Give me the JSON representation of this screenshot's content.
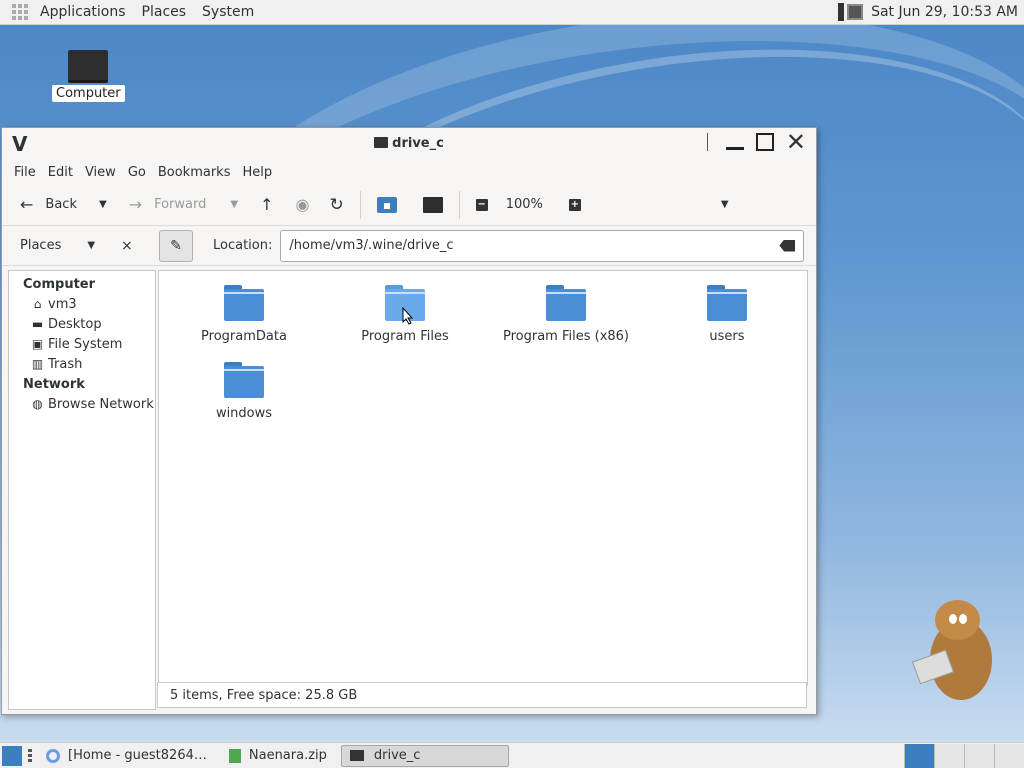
{
  "top_panel": {
    "menus": [
      "Applications",
      "Places",
      "System"
    ],
    "clock": "Sat Jun 29, 10:53 AM"
  },
  "desktop": {
    "icon_label": "Computer"
  },
  "window": {
    "logo": "V",
    "title": "drive_c",
    "menu": [
      "File",
      "Edit",
      "View",
      "Go",
      "Bookmarks",
      "Help"
    ],
    "toolbar": {
      "back": "Back",
      "forward": "Forward",
      "zoom": "100%"
    },
    "places": {
      "label": "Places",
      "close": "×"
    },
    "location": {
      "label": "Location:",
      "value": "/home/vm3/.wine/drive_c"
    },
    "sidebar": {
      "computer_heading": "Computer",
      "computer_items": [
        "vm3",
        "Desktop",
        "File System",
        "Trash"
      ],
      "network_heading": "Network",
      "network_items": [
        "Browse Network"
      ]
    },
    "files": [
      "ProgramData",
      "Program Files",
      "Program Files (x86)",
      "users",
      "windows"
    ],
    "status": "5 items, Free space: 25.8 GB"
  },
  "taskbar": {
    "tasks": [
      "[Home - guest8264…",
      "Naenara.zip",
      "drive_c"
    ]
  },
  "colors": {
    "folder": "#4a8fd6",
    "accent": "#3d7ebf"
  }
}
